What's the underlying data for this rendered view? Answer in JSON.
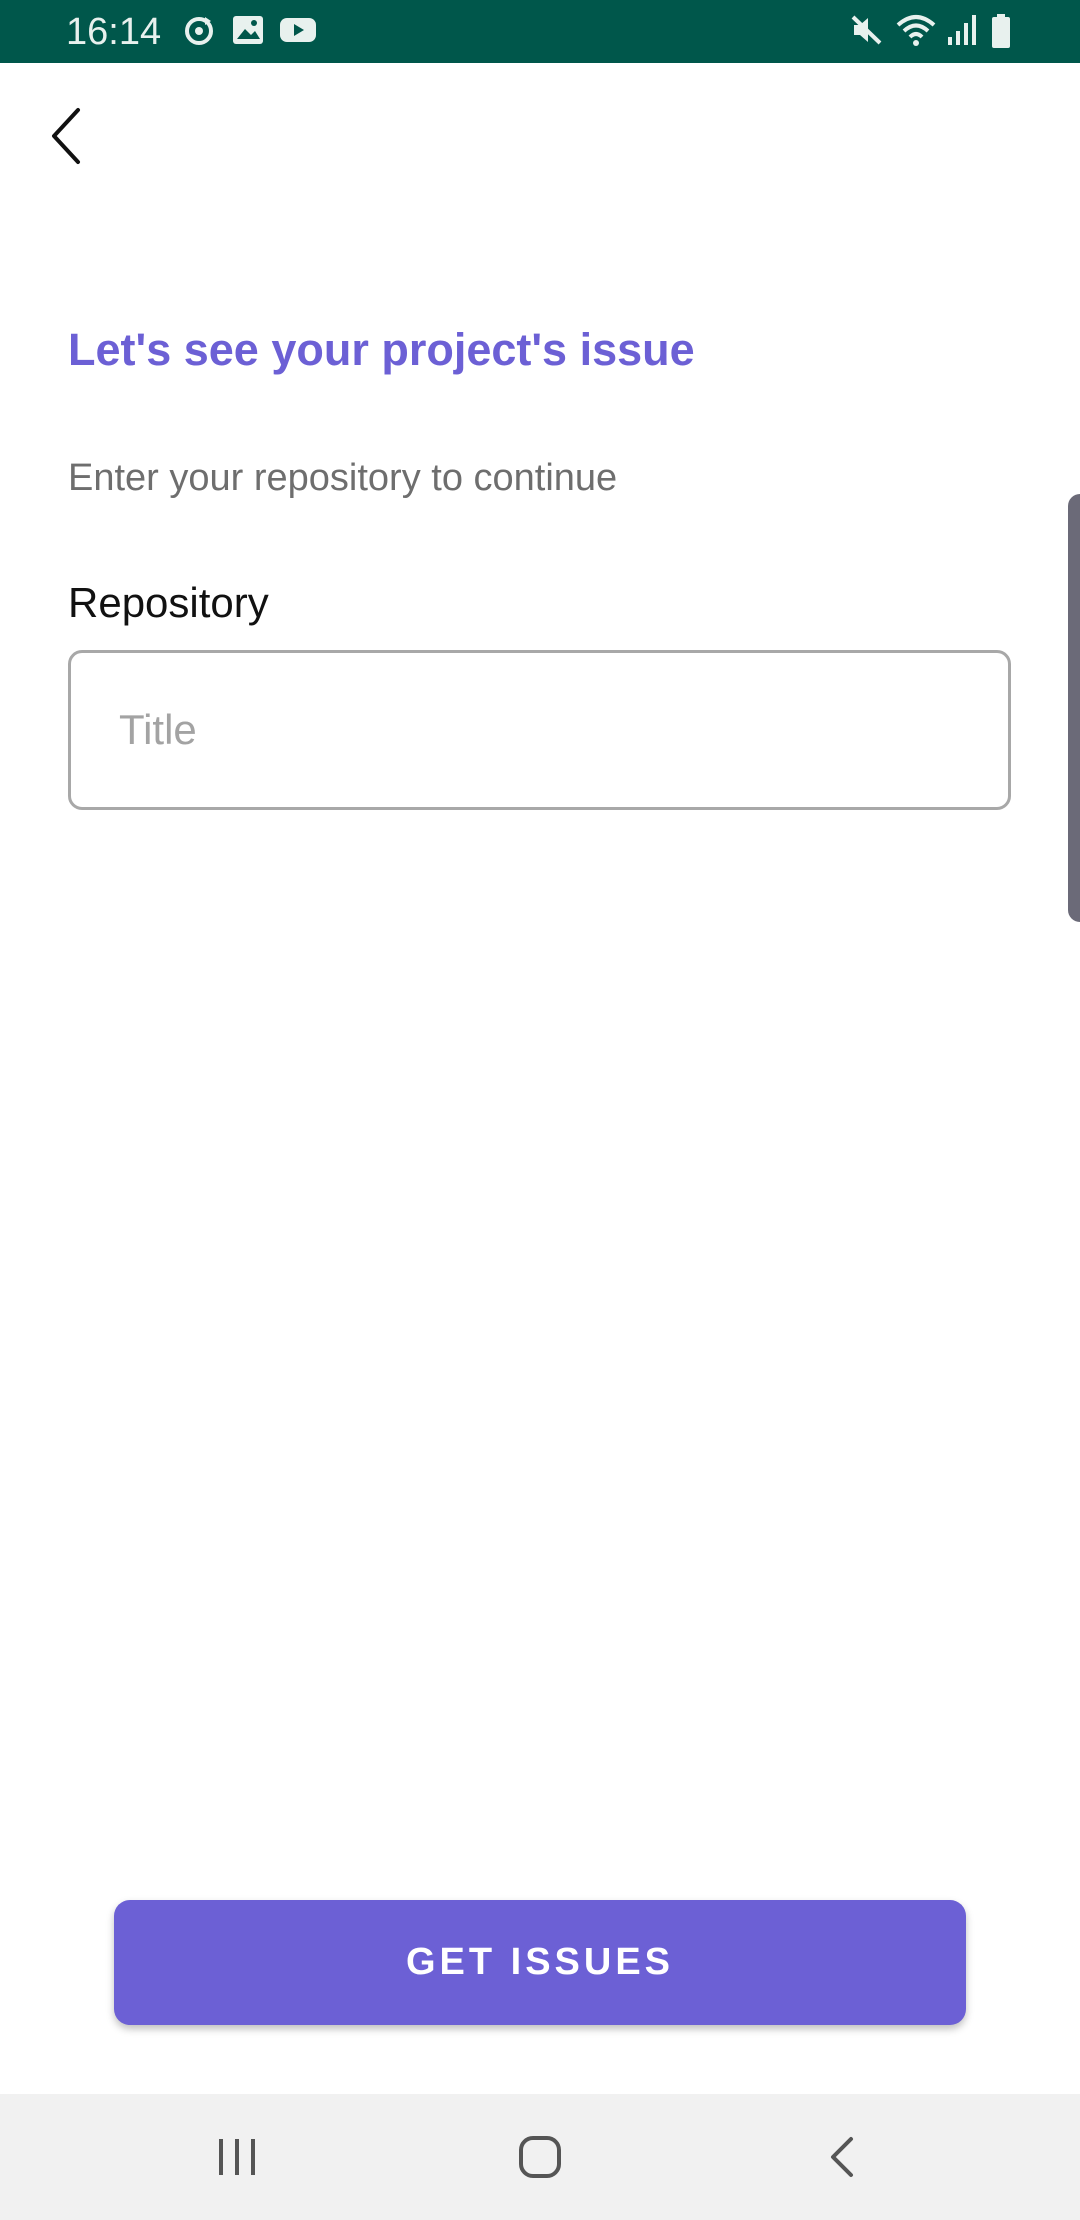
{
  "status_bar": {
    "time": "16:14",
    "left_icons": [
      "sync-icon",
      "image-icon",
      "youtube-icon"
    ],
    "right_icons": [
      "mute-icon",
      "wifi-icon",
      "signal-icon",
      "battery-icon"
    ],
    "background_color": "#00574b"
  },
  "header": {
    "back_icon": "chevron-left-icon"
  },
  "main": {
    "title": "Let's see your project's issue",
    "subtitle": "Enter your repository to continue",
    "repository_label": "Repository",
    "repository_input": {
      "value": "",
      "placeholder": "Title"
    }
  },
  "actions": {
    "get_issues_label": "GET ISSUES"
  },
  "nav_bar": {
    "buttons": [
      "recents-icon",
      "home-icon",
      "back-icon"
    ]
  },
  "colors": {
    "accent": "#6c60d5",
    "status_bar": "#00574b",
    "nav_bar": "#f1f1f1"
  }
}
